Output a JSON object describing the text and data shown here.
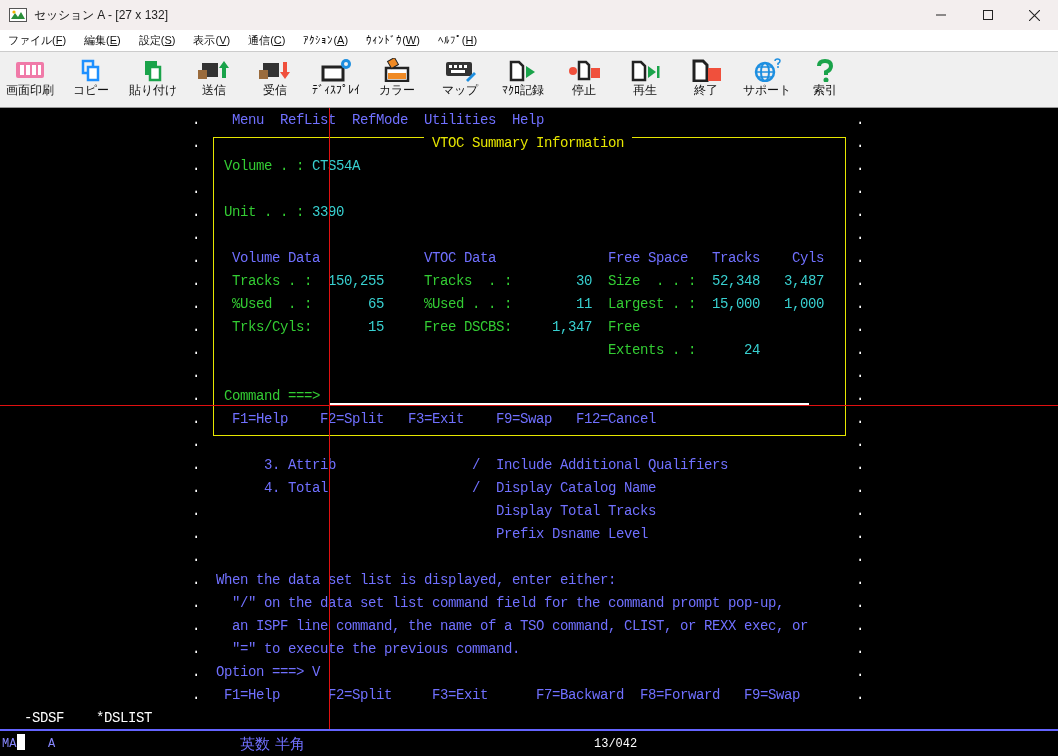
{
  "window": {
    "title": "セッション A - [27 x 132]"
  },
  "menu": [
    "ファイル(F)",
    "編集(E)",
    "設定(S)",
    "表示(V)",
    "通信(C)",
    "ｱｸｼｮﾝ(A)",
    "ｳｨﾝﾄﾞｳ(W)",
    "ﾍﾙﾌﾟ(H)"
  ],
  "toolbar": [
    "画面印刷",
    "コピー",
    "貼り付け",
    "送信",
    "受信",
    "ﾃﾞｨｽﾌﾟﾚｲ",
    "カラー",
    "マップ",
    "ﾏｸﾛ記録",
    "停止",
    "再生",
    "終了",
    "サポート",
    "索引"
  ],
  "terminal": {
    "action_bar": [
      "Menu",
      "RefList",
      "RefMode",
      "Utilities",
      "Help"
    ],
    "popup": {
      "title": "VTOC Summary Information",
      "fields": [
        {
          "label": "Volume . :",
          "value": "CTS54A"
        },
        {
          "label": "Unit . . :",
          "value": "3390"
        }
      ],
      "volume_data": {
        "heading": "Volume Data",
        "rows": [
          {
            "label": "Tracks . :",
            "value": "150,255"
          },
          {
            "label": "%Used  . :",
            "value": "65"
          },
          {
            "label": "Trks/Cyls:",
            "value": "15"
          }
        ]
      },
      "vtoc_data": {
        "heading": "VTOC Data",
        "rows": [
          {
            "label": "Tracks  . :",
            "value": "30"
          },
          {
            "label": "%Used . . :",
            "value": "11"
          },
          {
            "label": "Free DSCBS:",
            "value": "1,347"
          }
        ]
      },
      "free_space": {
        "heading": "Free Space",
        "columns": [
          "Tracks",
          "Cyls"
        ],
        "rows": [
          {
            "label": "Size  . . :",
            "tracks": "52,348",
            "cyls": "3,487"
          },
          {
            "label": "Largest . :",
            "tracks": "15,000",
            "cyls": "1,000"
          },
          {
            "label": "Free"
          },
          {
            "label": "Extents . :",
            "tracks": "24"
          }
        ]
      },
      "command_label": "Command ===>",
      "function_keys": [
        "F1=Help",
        "F2=Split",
        "F3=Exit",
        "F9=Swap",
        "F12=Cancel"
      ]
    },
    "options": [
      "3. Attrib",
      "4. Total"
    ],
    "settings": [
      {
        "mark": "/",
        "label": "Include Additional Qualifiers"
      },
      {
        "mark": "/",
        "label": "Display Catalog Name"
      },
      {
        "label": "Display Total Tracks"
      },
      {
        "label": "Prefix Dsname Level"
      }
    ],
    "instructions": [
      "When the data set list is displayed, enter either:",
      "\"/\" on the data set list command field for the command prompt pop-up,",
      "an ISPF line command, the name of a TSO command, CLIST, or REXX exec, or",
      "\"=\" to execute the previous command."
    ],
    "option_label": "Option ===>",
    "option_value": "V",
    "function_keys": [
      "F1=Help",
      "F2=Split",
      "F3=Exit",
      "F7=Backward",
      "F8=Forward",
      "F9=Swap"
    ],
    "edge_marks": {
      "left": [
        ".",
        ".",
        ".",
        ".",
        ".",
        ".",
        ".",
        ".",
        ".",
        ".",
        ".",
        ".",
        ".",
        ".",
        ".",
        ".",
        ".",
        ".",
        ".",
        ".",
        ".",
        ".",
        ".",
        ".",
        ".",
        "."
      ],
      "right": [
        ".",
        ".",
        ".",
        ".",
        ".",
        ".",
        ".",
        ".",
        ".",
        ".",
        ".",
        ".",
        ".",
        ".",
        ".",
        ".",
        ".",
        ".",
        ".",
        ".",
        ".",
        ".",
        ".",
        ".",
        ".",
        "."
      ]
    },
    "screens": [
      "-SDSF",
      "*DSLIST"
    ]
  },
  "status_bar": {
    "mode": "MA",
    "field_2": "A",
    "input_mode": "英数 半角",
    "cursor_position": "13/042"
  }
}
